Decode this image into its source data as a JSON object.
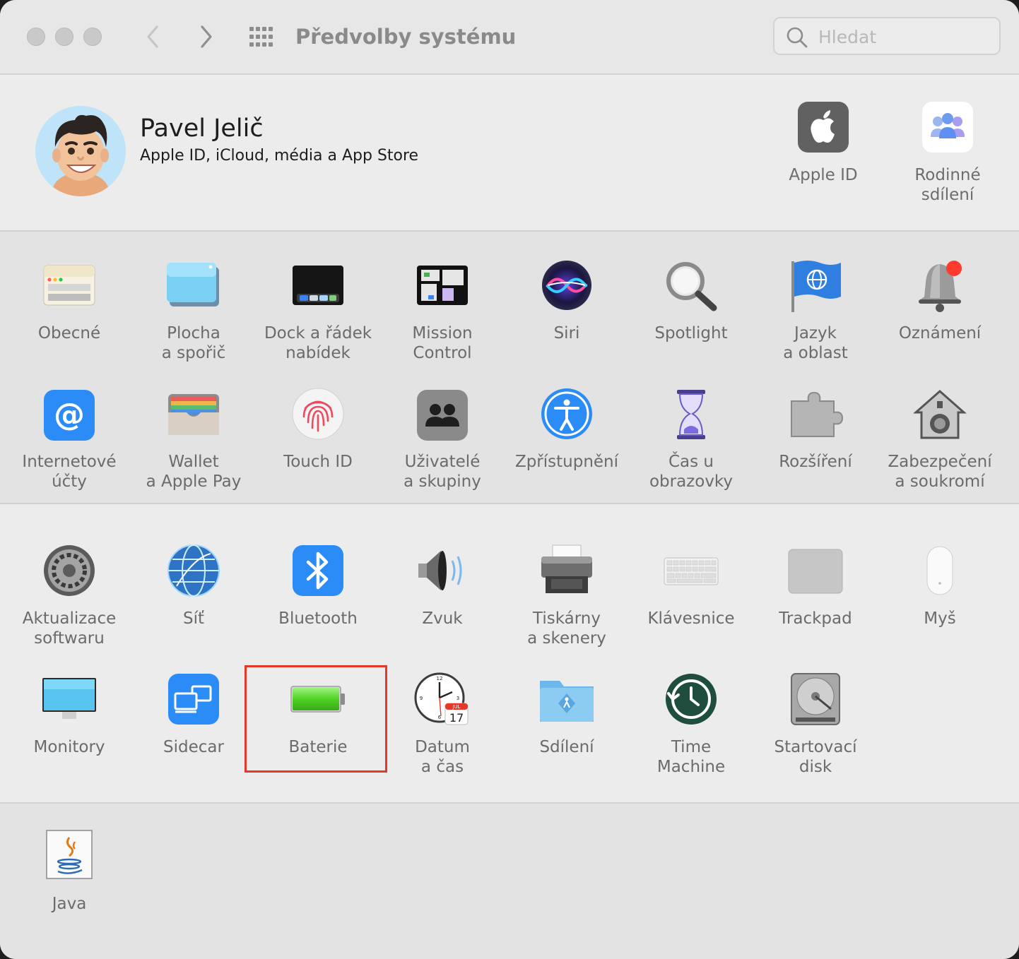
{
  "window": {
    "title": "Předvolby systému",
    "search_placeholder": "Hledat"
  },
  "account": {
    "name": "Pavel Jelič",
    "subtitle": "Apple ID, iCloud, média a App Store",
    "items": [
      {
        "label": "Apple ID",
        "icon": "apple-id-icon"
      },
      {
        "label": "Rodinné\nsdílení",
        "icon": "family-sharing-icon"
      }
    ]
  },
  "panes": {
    "row1": [
      {
        "label": "Obecné",
        "icon": "general-icon"
      },
      {
        "label": "Plocha\na spořič",
        "icon": "desktop-screensaver-icon"
      },
      {
        "label": "Dock a řádek\nnabídek",
        "icon": "dock-icon"
      },
      {
        "label": "Mission\nControl",
        "icon": "mission-control-icon"
      },
      {
        "label": "Siri",
        "icon": "siri-icon"
      },
      {
        "label": "Spotlight",
        "icon": "spotlight-icon"
      },
      {
        "label": "Jazyk\na oblast",
        "icon": "language-region-icon"
      },
      {
        "label": "Oznámení",
        "icon": "notifications-icon"
      }
    ],
    "row2": [
      {
        "label": "Internetové\núčty",
        "icon": "internet-accounts-icon"
      },
      {
        "label": "Wallet\na Apple Pay",
        "icon": "wallet-icon"
      },
      {
        "label": "Touch ID",
        "icon": "touch-id-icon"
      },
      {
        "label": "Uživatelé\na skupiny",
        "icon": "users-groups-icon"
      },
      {
        "label": "Zpřístupnění",
        "icon": "accessibility-icon"
      },
      {
        "label": "Čas u obrazovky",
        "icon": "screen-time-icon"
      },
      {
        "label": "Rozšíření",
        "icon": "extensions-icon"
      },
      {
        "label": "Zabezpečení\na soukromí",
        "icon": "security-privacy-icon"
      }
    ],
    "row3": [
      {
        "label": "Aktualizace\nsoftwaru",
        "icon": "software-update-icon"
      },
      {
        "label": "Síť",
        "icon": "network-icon"
      },
      {
        "label": "Bluetooth",
        "icon": "bluetooth-icon"
      },
      {
        "label": "Zvuk",
        "icon": "sound-icon"
      },
      {
        "label": "Tiskárny\na skenery",
        "icon": "printers-scanners-icon"
      },
      {
        "label": "Klávesnice",
        "icon": "keyboard-icon"
      },
      {
        "label": "Trackpad",
        "icon": "trackpad-icon"
      },
      {
        "label": "Myš",
        "icon": "mouse-icon"
      }
    ],
    "row4": [
      {
        "label": "Monitory",
        "icon": "displays-icon"
      },
      {
        "label": "Sidecar",
        "icon": "sidecar-icon"
      },
      {
        "label": "Baterie",
        "icon": "battery-icon"
      },
      {
        "label": "Datum\na čas",
        "icon": "date-time-icon"
      },
      {
        "label": "Sdílení",
        "icon": "sharing-icon"
      },
      {
        "label": "Time\nMachine",
        "icon": "time-machine-icon"
      },
      {
        "label": "Startovací\ndisk",
        "icon": "startup-disk-icon"
      }
    ],
    "row5": [
      {
        "label": "Java",
        "icon": "java-icon"
      }
    ]
  },
  "datetime_icon": {
    "month": "JUL",
    "day": "17"
  },
  "colors": {
    "highlight": "#e2392b",
    "window_bg": "#ececec"
  }
}
